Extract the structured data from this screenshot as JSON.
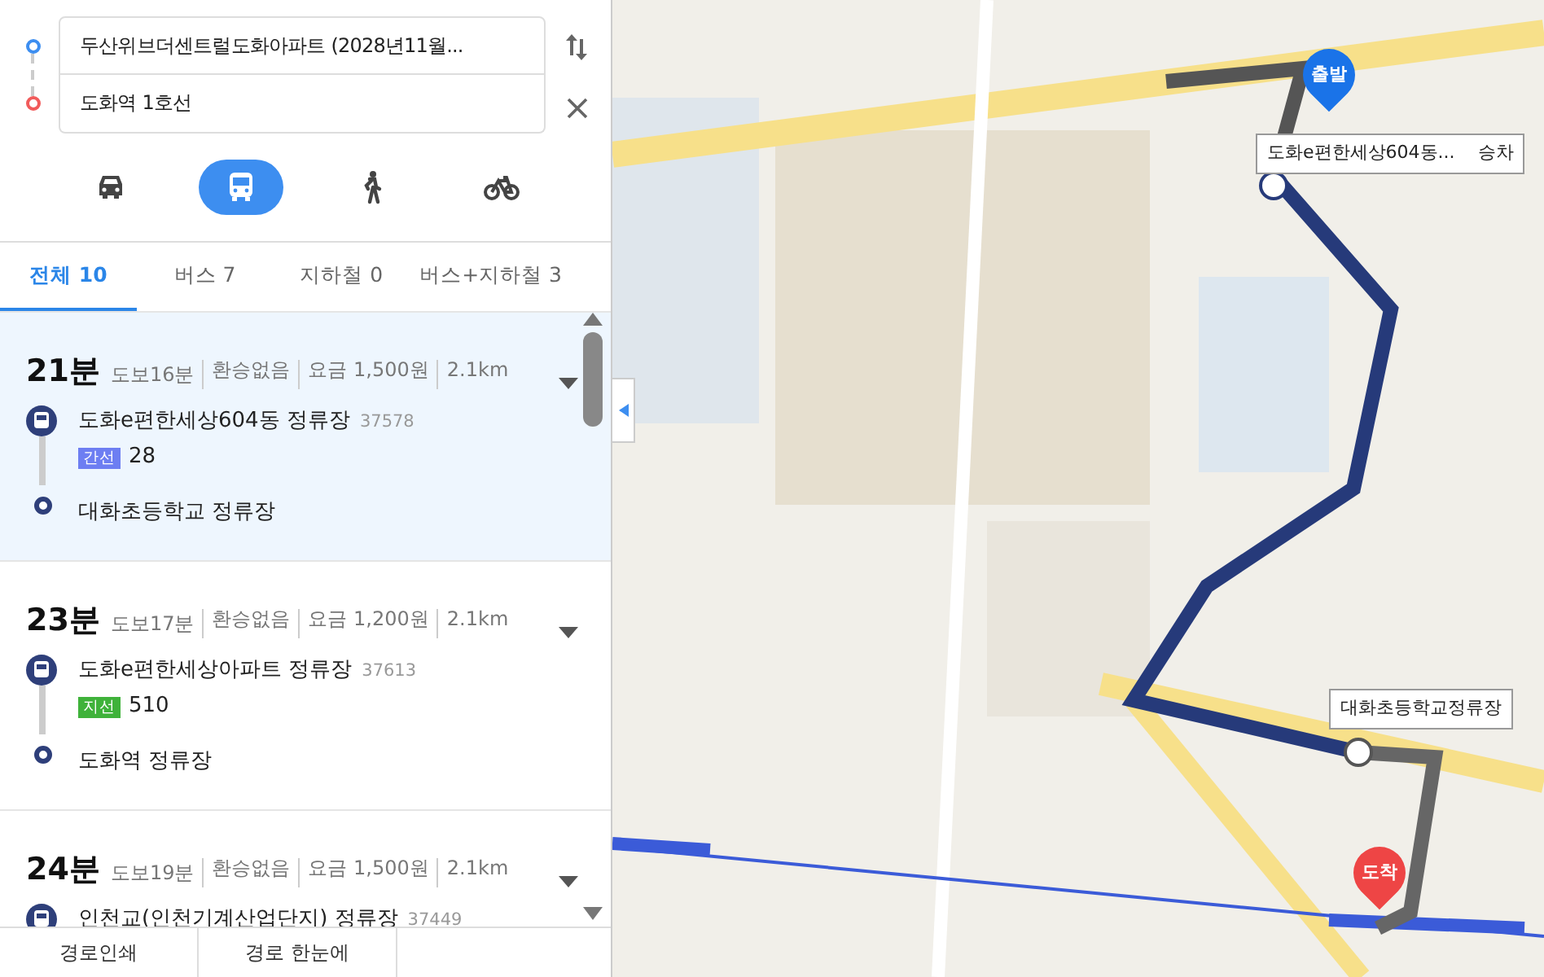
{
  "search": {
    "origin": "두산위브더센트럴도화아파트 (2028년11월...",
    "destination": "도화역 1호선"
  },
  "modes": [
    {
      "kind": "car",
      "selected": false
    },
    {
      "kind": "bus",
      "selected": true
    },
    {
      "kind": "walk",
      "selected": false
    },
    {
      "kind": "bike",
      "selected": false
    }
  ],
  "tabs": [
    {
      "label": "전체 10",
      "selected": true
    },
    {
      "label": "버스 7",
      "selected": false
    },
    {
      "label": "지하철 0",
      "selected": false
    },
    {
      "label": "버스+지하철 3",
      "selected": false
    }
  ],
  "routes": [
    {
      "time": "21분",
      "details": [
        "도보16분",
        "환승없음",
        "요금 1,500원",
        "2.1km"
      ],
      "selected": true,
      "board_stop": "도화e편한세상604동 정류장",
      "stop_id": "37578",
      "bus_type": "간선",
      "color": "#6d7ef2",
      "bus_no": "28",
      "alight_stop": "대화초등학교 정류장"
    },
    {
      "time": "23분",
      "details": [
        "도보17분",
        "환승없음",
        "요금 1,200원",
        "2.1km"
      ],
      "selected": false,
      "board_stop": "도화e편한세상아파트 정류장",
      "stop_id": "37613",
      "bus_type": "지선",
      "color": "#3fb23a",
      "bus_no": "510",
      "alight_stop": "도화역 정류장"
    },
    {
      "time": "24분",
      "details": [
        "도보19분",
        "환승없음",
        "요금 1,500원",
        "2.1km"
      ],
      "selected": false,
      "board_stop": "인천교(인천기계산업단지) 정류장",
      "stop_id": "37449"
    }
  ],
  "footer": [
    "경로인쇄",
    "경로 한눈에"
  ],
  "map": {
    "start_pin": "출발",
    "end_pin": "도착",
    "board_callout": {
      "stop": "도화e편한세상604동...",
      "action": "승차"
    },
    "alight_callout": "대화초등학교정류장"
  }
}
